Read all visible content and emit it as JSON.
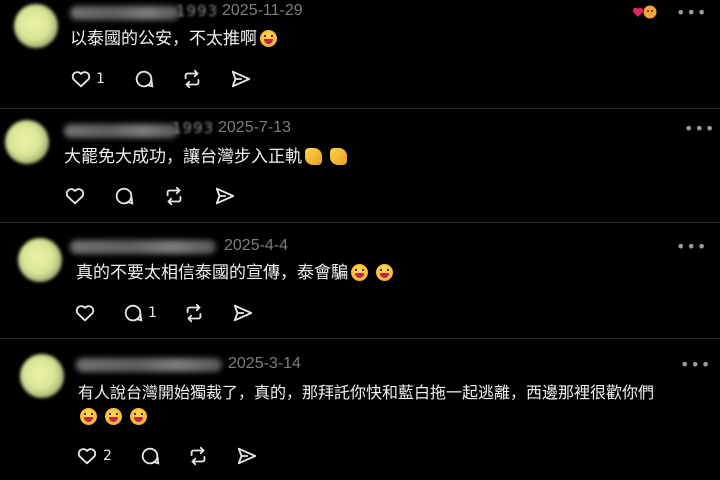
{
  "comments": [
    {
      "username_tail": "1993",
      "date": "2025-11-29",
      "more_label": "•••",
      "text": "以泰國的公安，不太推啊",
      "emojis": [
        "grin-emoji"
      ],
      "like_count": "1",
      "reply_count": "",
      "has_reactions_badge": true
    },
    {
      "username_tail": "1993",
      "date": "2025-7-13",
      "more_label": "•••",
      "text": "大罷免大成功，讓台灣步入正軌",
      "emojis": [
        "muscle-emoji",
        "muscle-emoji"
      ],
      "like_count": "",
      "reply_count": ""
    },
    {
      "username_tail": "",
      "date": "2025-4-4",
      "more_label": "•••",
      "text": "真的不要太相信泰國的宣傳，泰會騙",
      "emojis": [
        "grin-emoji",
        "grin-emoji"
      ],
      "like_count": "",
      "reply_count": "1"
    },
    {
      "username_tail": "",
      "date": "2025-3-14",
      "more_label": "•••",
      "text_line1": "有人說台灣開始獨裁了，真的，那拜託你快和藍白拖一起逃離，西邊那裡很歡你們",
      "emojis": [
        "grin-emoji",
        "grin-emoji",
        "grin-emoji"
      ],
      "like_count": "2",
      "reply_count": ""
    }
  ],
  "colors": {
    "background": "#000000",
    "text": "#f0f0f0",
    "meta": "#7d7d7d",
    "heart_badge": "#e0245e"
  }
}
